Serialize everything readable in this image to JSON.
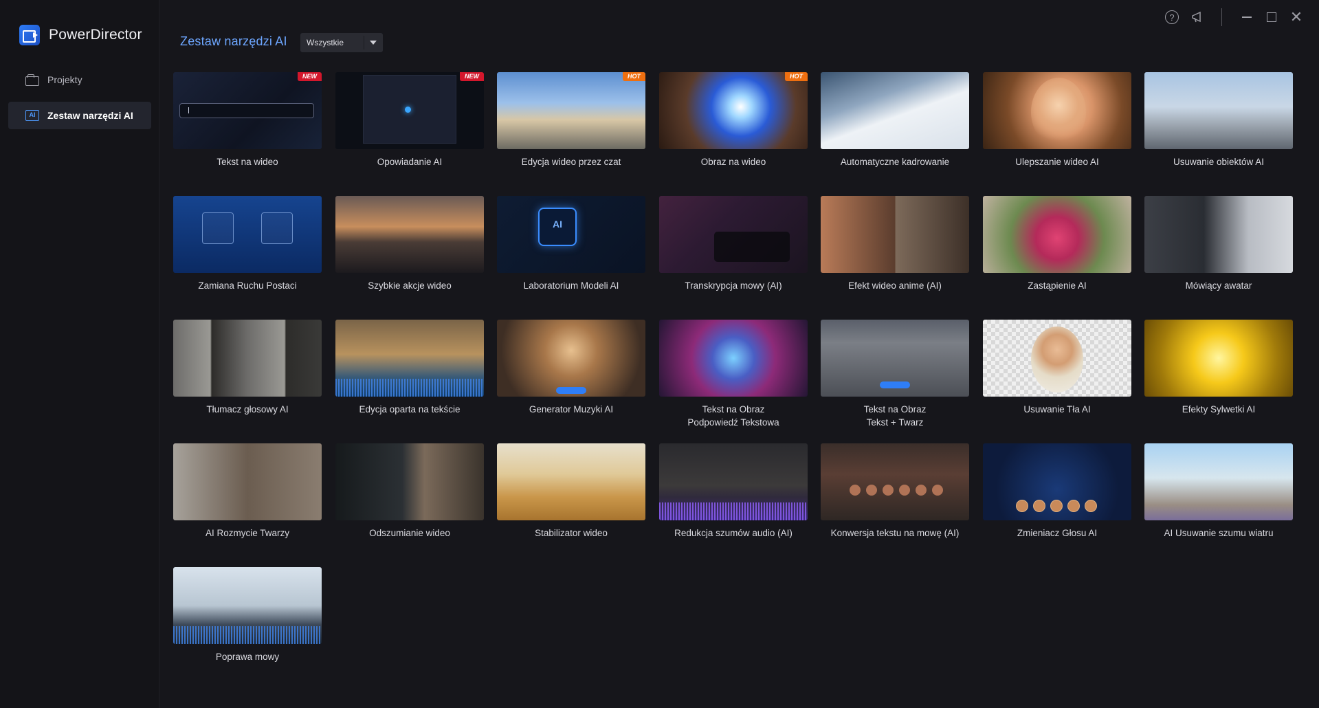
{
  "app": {
    "title": "PowerDirector"
  },
  "sidebar": {
    "items": [
      {
        "label": "Projekty",
        "icon": "folder-icon",
        "active": false
      },
      {
        "label": "Zestaw narzędzi AI",
        "icon": "ai-toolbox-icon",
        "active": true
      }
    ]
  },
  "window_controls": {
    "help": "?",
    "close": "✕"
  },
  "header": {
    "title": "Zestaw narzędzi AI",
    "filter": {
      "selected": "Wszystkie"
    }
  },
  "tools": [
    {
      "label": "Tekst na wideo",
      "badge": "NEW",
      "thumb": "t-dark"
    },
    {
      "label": "Opowiadanie AI",
      "badge": "NEW",
      "thumb": "t-screen"
    },
    {
      "label": "Edycja wideo przez czat",
      "badge": "HOT",
      "thumb": "t-sky"
    },
    {
      "label": "Obraz na wideo",
      "badge": "HOT",
      "thumb": "t-neon"
    },
    {
      "label": "Automatyczne kadrowanie",
      "badge": "",
      "thumb": "t-snow"
    },
    {
      "label": "Ulepszanie wideo AI",
      "badge": "",
      "thumb": "t-face1"
    },
    {
      "label": "Usuwanie obiektów AI",
      "badge": "",
      "thumb": "t-harbor"
    },
    {
      "label": "Zamiana Ruchu Postaci",
      "badge": "",
      "thumb": "t-blue"
    },
    {
      "label": "Szybkie akcje wideo",
      "badge": "",
      "thumb": "t-car"
    },
    {
      "label": "Laboratorium Modeli AI",
      "badge": "",
      "thumb": "t-lab"
    },
    {
      "label": "Transkrypcja mowy (AI)",
      "badge": "",
      "thumb": "t-talk"
    },
    {
      "label": "Efekt wideo anime (AI)",
      "badge": "",
      "thumb": "t-anime"
    },
    {
      "label": "Zastąpienie AI",
      "badge": "",
      "thumb": "t-pink"
    },
    {
      "label": "Mówiący awatar",
      "badge": "",
      "thumb": "t-avatar"
    },
    {
      "label": "Tłumacz głosowy AI",
      "badge": "",
      "thumb": "t-grey2"
    },
    {
      "label": "Edycja oparta na tekście",
      "badge": "",
      "thumb": "t-edit"
    },
    {
      "label": "Generator Muzyki AI",
      "badge": "",
      "thumb": "t-music"
    },
    {
      "label": "Tekst na Obraz\nPodpowiedź Tekstowa",
      "badge": "",
      "thumb": "t-collage"
    },
    {
      "label": "Tekst na Obraz\nTekst + Twarz",
      "badge": "",
      "thumb": "t-wood"
    },
    {
      "label": "Usuwanie Tła AI",
      "badge": "",
      "thumb": "t-check"
    },
    {
      "label": "Efekty Sylwetki AI",
      "badge": "",
      "thumb": "t-gold"
    },
    {
      "label": "AI Rozmycie Twarzy",
      "badge": "",
      "thumb": "t-office"
    },
    {
      "label": "Odszumianie wideo",
      "badge": "",
      "thumb": "t-eye"
    },
    {
      "label": "Stabilizator wideo",
      "badge": "",
      "thumb": "t-desert"
    },
    {
      "label": "Redukcja szumów audio (AI)",
      "badge": "",
      "thumb": "t-studio"
    },
    {
      "label": "Konwersja tekstu na mowę (AI)",
      "badge": "",
      "thumb": "t-laptop"
    },
    {
      "label": "Zmieniacz Głosu AI",
      "badge": "",
      "thumb": "t-voice"
    },
    {
      "label": "AI Usuwanie szumu wiatru",
      "badge": "",
      "thumb": "t-palm"
    },
    {
      "label": "Poprawa mowy",
      "badge": "",
      "thumb": "t-speech"
    }
  ],
  "colors": {
    "accent": "#6da6ff",
    "badge_new": "#d3172c",
    "badge_hot": "#ee6f10",
    "background": "#16161b",
    "sidebar_active": "#23252e"
  }
}
